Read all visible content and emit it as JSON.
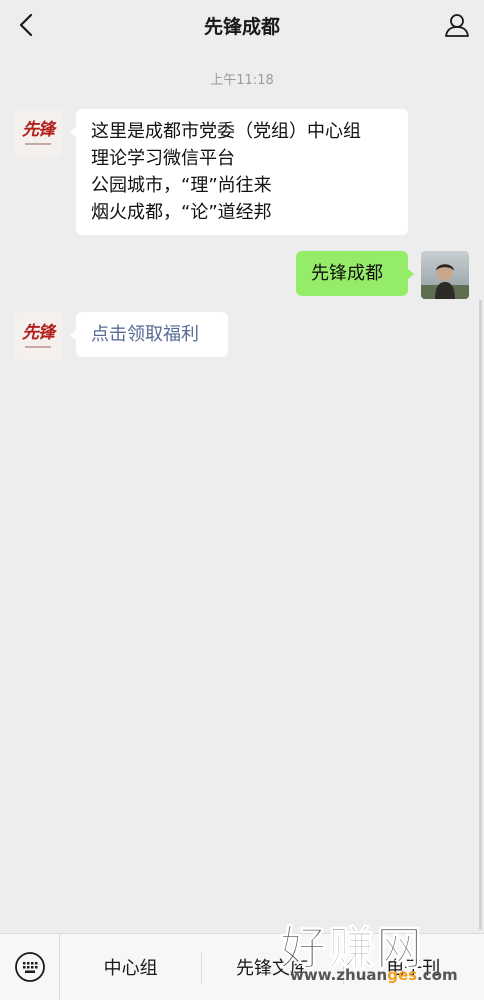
{
  "header": {
    "title": "先锋成都",
    "back_icon": "chevron-left-icon",
    "profile_icon": "person-icon"
  },
  "chat": {
    "timestamp": "上午11:18",
    "messages": [
      {
        "sender": "official-account",
        "lines": [
          "这里是成都市党委（党组）中心组",
          "理论学习微信平台",
          "公园城市，“理”尚往来",
          "烟火成都，“论”道经邦"
        ]
      },
      {
        "sender": "user",
        "text": "先锋成都"
      },
      {
        "sender": "official-account",
        "text": "点击领取福利",
        "is_link": true
      }
    ],
    "account_logo_text": "先锋"
  },
  "bottom_menu": {
    "keyboard_icon": "keyboard-icon",
    "items": [
      "中心组",
      "先锋文库",
      "电子刊"
    ]
  },
  "watermark": {
    "big": "好赚网",
    "small_prefix": "www.zhuan",
    "small_accent": "ges",
    "small_suffix": ".com"
  },
  "colors": {
    "background": "#ededed",
    "user_bubble": "#95ec69",
    "link": "#576b95",
    "logo_red": "#b3211c"
  }
}
